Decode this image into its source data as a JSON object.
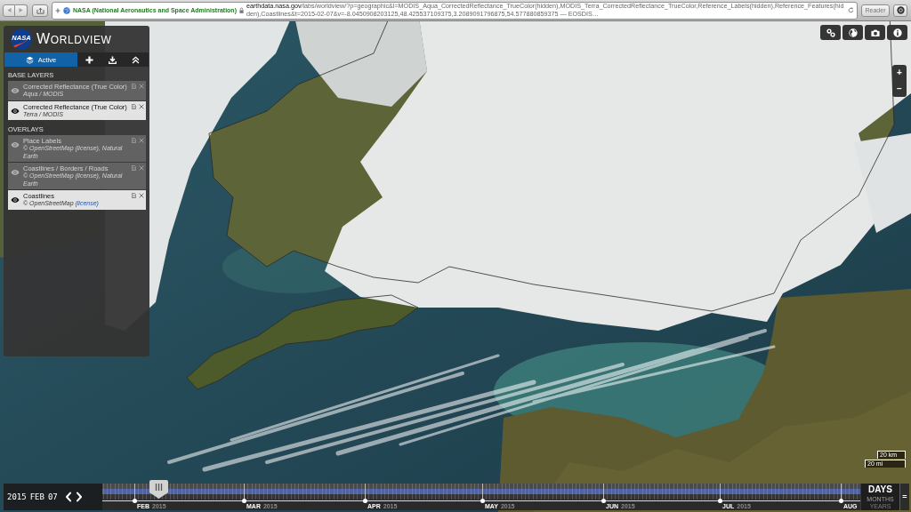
{
  "browser": {
    "ev_label": "NASA (National Aeronautics and Space Administration)",
    "url": "**earthdata.nasa.gov**/labs/worldview/?p=geographic&l=MODIS_Aqua_CorrectedReflectance_TrueColor(hidden),MODIS_Terra_CorrectedReflectance_TrueColor,Reference_Labels(hidden),Reference_Features(hidden),Coastlines&t=2015-02-07&v=-8.0450908203125,48.425537109375,3.2089091796875,54.577880859375 — EOSDIS…",
    "reader_button": "Reader"
  },
  "sidebar": {
    "logo_text": "NASA",
    "title": "WORLDVIEW",
    "tabs": [
      {
        "label": "Active",
        "selected": true
      }
    ],
    "groups": [
      {
        "heading": "BASE LAYERS",
        "layers": [
          {
            "title": "Corrected Reflectance (True Color)",
            "subtitle": "Aqua / MODIS",
            "visible": false
          },
          {
            "title": "Corrected Reflectance (True Color)",
            "subtitle": "Terra / MODIS",
            "visible": true
          }
        ]
      },
      {
        "heading": "OVERLAYS",
        "layers": [
          {
            "title": "Place Labels",
            "subtitle": "© OpenStreetMap",
            "link": "(license)",
            "subtitle_end": ", Natural Earth",
            "visible": false
          },
          {
            "title": "Coastlines / Borders / Roads",
            "subtitle": "© OpenStreetMap",
            "link": "(license)",
            "subtitle_end": ", Natural Earth",
            "visible": false
          },
          {
            "title": "Coastlines",
            "subtitle": "© OpenStreetMap",
            "link": "(license)",
            "visible": true
          }
        ]
      }
    ]
  },
  "map": {
    "zoom_buttons": [
      "+",
      "−"
    ],
    "scale_bar": [
      "20 km",
      "20 mi"
    ]
  },
  "timeline": {
    "date_parts": [
      "2015",
      "FEB",
      "07"
    ],
    "level": 0.074,
    "months": [
      {
        "month": "FEB",
        "year": "2015"
      },
      {
        "month": "MAR",
        "year": "2015"
      },
      {
        "month": "APR",
        "year": "2015"
      },
      {
        "month": "MAY",
        "year": "2015"
      },
      {
        "month": "JUN",
        "year": "2015"
      },
      {
        "month": "JUL",
        "year": "2015"
      },
      {
        "month": "AUG"
      }
    ],
    "zoom_levels": [
      {
        "label": "DAYS",
        "selected": true
      },
      {
        "label": "MONTHS",
        "selected": false
      },
      {
        "label": "YEARS",
        "selected": false
      }
    ],
    "toggle": "="
  }
}
